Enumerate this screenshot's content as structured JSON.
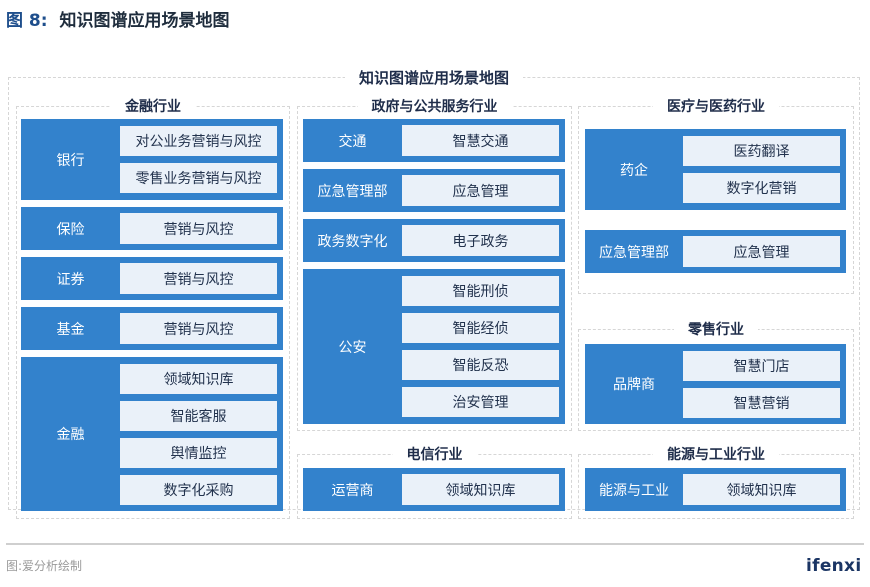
{
  "figure": {
    "number": "图 8:",
    "title": "知识图谱应用场景地图",
    "diagram_title": "知识图谱应用场景地图",
    "source": "图:爱分析绘制",
    "logo": "ifenxi"
  },
  "colors": {
    "block": "#3382cc",
    "item": "#eaf1f9",
    "title": "#1f2d4a"
  },
  "panels": {
    "finance": {
      "title": "金融行业",
      "groups": [
        {
          "label": "银行",
          "items": [
            "对公业务营销与风控",
            "零售业务营销与风控"
          ]
        },
        {
          "label": "保险",
          "items": [
            "营销与风控"
          ]
        },
        {
          "label": "证券",
          "items": [
            "营销与风控"
          ]
        },
        {
          "label": "基金",
          "items": [
            "营销与风控"
          ]
        },
        {
          "label": "金融",
          "items": [
            "领域知识库",
            "智能客服",
            "舆情监控",
            "数字化采购"
          ]
        }
      ]
    },
    "government": {
      "title": "政府与公共服务行业",
      "groups": [
        {
          "label": "交通",
          "items": [
            "智慧交通"
          ]
        },
        {
          "label": "应急管理部",
          "items": [
            "应急管理"
          ]
        },
        {
          "label": "政务数字化",
          "items": [
            "电子政务"
          ]
        },
        {
          "label": "公安",
          "items": [
            "智能刑侦",
            "智能经侦",
            "智能反恐",
            "治安管理"
          ]
        }
      ]
    },
    "medical": {
      "title": "医疗与医药行业",
      "groups": [
        {
          "label": "药企",
          "items": [
            "医药翻译",
            "数字化营销"
          ]
        },
        {
          "label": "应急管理部",
          "items": [
            "应急管理"
          ]
        }
      ]
    },
    "retail": {
      "title": "零售行业",
      "groups": [
        {
          "label": "品牌商",
          "items": [
            "智慧门店",
            "智慧营销"
          ]
        }
      ]
    },
    "telecom": {
      "title": "电信行业",
      "groups": [
        {
          "label": "运营商",
          "items": [
            "领域知识库"
          ]
        }
      ]
    },
    "energy": {
      "title": "能源与工业行业",
      "groups": [
        {
          "label": "能源与工业",
          "items": [
            "领域知识库"
          ]
        }
      ]
    }
  }
}
